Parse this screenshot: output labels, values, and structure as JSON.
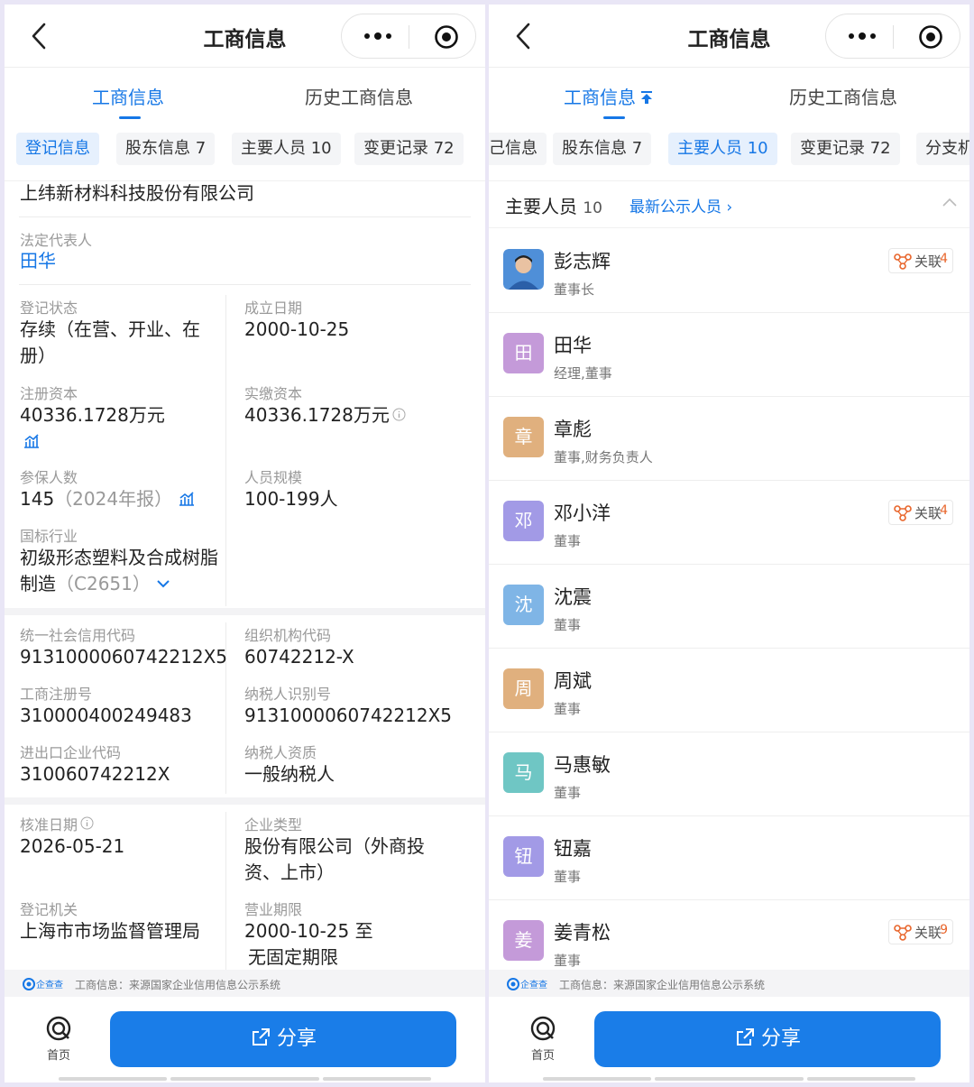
{
  "left": {
    "header": {
      "title": "工商信息"
    },
    "tabs": {
      "tab1": "工商信息",
      "tab2": "历史工商信息"
    },
    "chips": [
      "登记信息",
      "股东信息 7",
      "主要人员 10",
      "变更记录 72"
    ],
    "company_name": "上纬新材料科技股份有限公司",
    "legal_rep": {
      "label": "法定代表人",
      "value": "田华"
    },
    "reg_status": {
      "label": "登记状态",
      "line1": "存续（在营、开业、在",
      "line2": "册）"
    },
    "est_date": {
      "label": "成立日期",
      "value": "2000-10-25"
    },
    "reg_capital": {
      "label": "注册资本",
      "value": "40336.1728万元"
    },
    "paid_capital": {
      "label": "实缴资本",
      "value": "40336.1728万元"
    },
    "insured": {
      "label": "参保人数",
      "value": "145",
      "note": "（2024年报）"
    },
    "staff_size": {
      "label": "人员规模",
      "value": "100-199人"
    },
    "industry": {
      "label": "国标行业",
      "line1": "初级形态塑料及合成树脂",
      "line2": "制造",
      "code": "（C2651）"
    },
    "credit_code": {
      "label": "统一社会信用代码",
      "value": "913100006074221 2X5"
    },
    "org_code": {
      "label": "组织机构代码",
      "value": "60742212-X"
    },
    "biz_reg_no": {
      "label": "工商注册号",
      "value": "310000400249483"
    },
    "taxpayer_id": {
      "label": "纳税人识别号",
      "value": "91310000607422 12X5"
    },
    "import_export_code": {
      "label": "进出口企业代码",
      "value": "310060742212X"
    },
    "taxpayer_type": {
      "label": "纳税人资质",
      "value": "一般纳税人"
    },
    "approval_date": {
      "label": "核准日期",
      "value": "2026-05-21"
    },
    "company_type": {
      "label": "企业类型",
      "line1": "股份有限公司（外商投",
      "line2": "资、上市）"
    },
    "reg_authority": {
      "label": "登记机关",
      "value": "上海市市场监督管理局"
    },
    "biz_term": {
      "label": "营业期限",
      "line1": "2000-10-25 至",
      "line2": "无固定期限"
    },
    "source": {
      "logo": "企查查",
      "text": "工商信息：来源国家企业信用信息公示系统"
    },
    "footer": {
      "home": "首页",
      "share": "分享"
    }
  },
  "right": {
    "header": {
      "title": "工商信息"
    },
    "tabs": {
      "tab1": "工商信息",
      "tab2": "历史工商信息"
    },
    "chips": [
      "己信息",
      "股东信息 7",
      "主要人员 10",
      "变更记录 72",
      "分支机"
    ],
    "section": {
      "title": "主要人员",
      "count": "10",
      "link": "最新公示人员 ›"
    },
    "people": [
      {
        "avatar": "",
        "name": "彭志辉",
        "role": "董事长",
        "tag": "关联",
        "tag_count": "4",
        "color": "#5b8fd6"
      },
      {
        "avatar": "田",
        "name": "田华",
        "role": "经理,董事",
        "tag": "",
        "tag_count": "",
        "color": "#c49ad9"
      },
      {
        "avatar": "章",
        "name": "章彪",
        "role": "董事,财务负责人",
        "tag": "",
        "tag_count": "",
        "color": "#e0b07e"
      },
      {
        "avatar": "邓",
        "name": "邓小洋",
        "role": "董事",
        "tag": "关联",
        "tag_count": "4",
        "color": "#a29ae6"
      },
      {
        "avatar": "沈",
        "name": "沈震",
        "role": "董事",
        "tag": "",
        "tag_count": "",
        "color": "#7fb5e6"
      },
      {
        "avatar": "周",
        "name": "周斌",
        "role": "董事",
        "tag": "",
        "tag_count": "",
        "color": "#e0b07e"
      },
      {
        "avatar": "马",
        "name": "马惠敏",
        "role": "董事",
        "tag": "",
        "tag_count": "",
        "color": "#6fc6c4"
      },
      {
        "avatar": "钮",
        "name": "钮嘉",
        "role": "董事",
        "tag": "",
        "tag_count": "",
        "color": "#a29ae6"
      },
      {
        "avatar": "姜",
        "name": "姜青松",
        "role": "董事",
        "tag": "关联",
        "tag_count": "9",
        "color": "#c49ad9"
      }
    ],
    "source": {
      "logo": "企查查",
      "text": "工商信息：来源国家企业信用信息公示系统"
    },
    "footer": {
      "home": "首页",
      "share": "分享"
    }
  },
  "colors": {
    "accent": "#1677e6",
    "share_button": "#1a7de8",
    "tag_number": "#e8652b"
  }
}
